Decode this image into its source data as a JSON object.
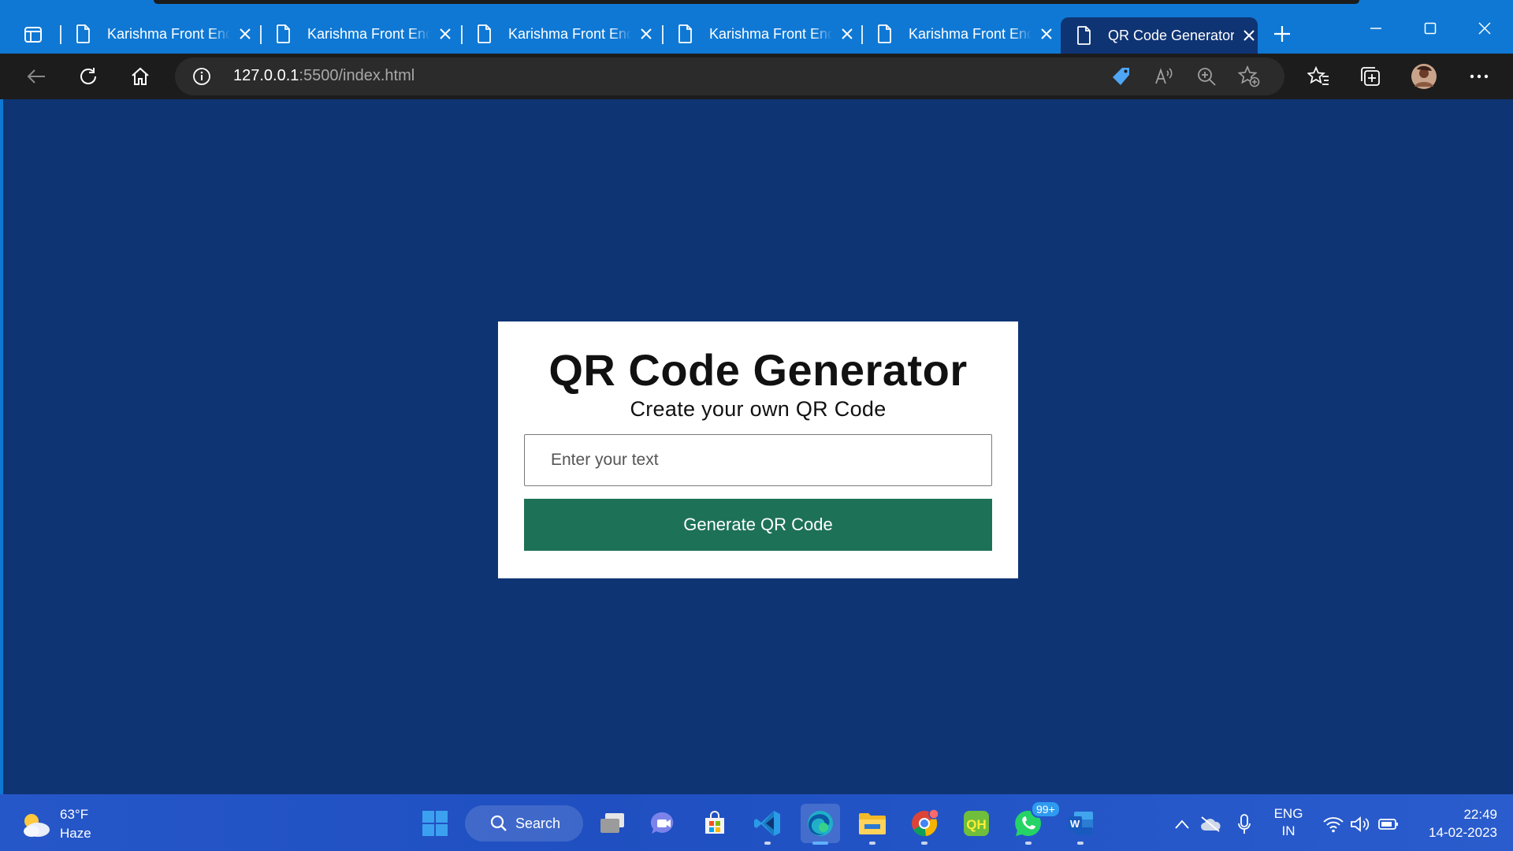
{
  "browser": {
    "tabs": [
      {
        "label": "Karishma Front End",
        "active": false
      },
      {
        "label": "Karishma Front End",
        "active": false
      },
      {
        "label": "Karishma Front End",
        "active": false
      },
      {
        "label": "Karishma Front End",
        "active": false
      },
      {
        "label": "Karishma Front End",
        "active": false
      },
      {
        "label": "QR Code Generator",
        "active": true
      }
    ],
    "address": {
      "host": "127.0.0.1",
      "path": ":5500/index.html"
    }
  },
  "page": {
    "title": "QR Code Generator",
    "subtitle": "Create your own QR Code",
    "input_placeholder": "Enter your text",
    "input_value": "",
    "button_label": "Generate QR Code"
  },
  "taskbar": {
    "weather": {
      "temp": "63°F",
      "condition": "Haze"
    },
    "search_label": "Search",
    "whatsapp_badge": "99+",
    "language": {
      "line1": "ENG",
      "line2": "IN"
    },
    "clock": {
      "time": "22:49",
      "date": "14-02-2023"
    }
  },
  "colors": {
    "tab_bar": "#0f78d4",
    "toolbar": "#1c1c1c",
    "page_background": "#0f3474",
    "button": "#1d7157",
    "card": "#ffffff"
  }
}
